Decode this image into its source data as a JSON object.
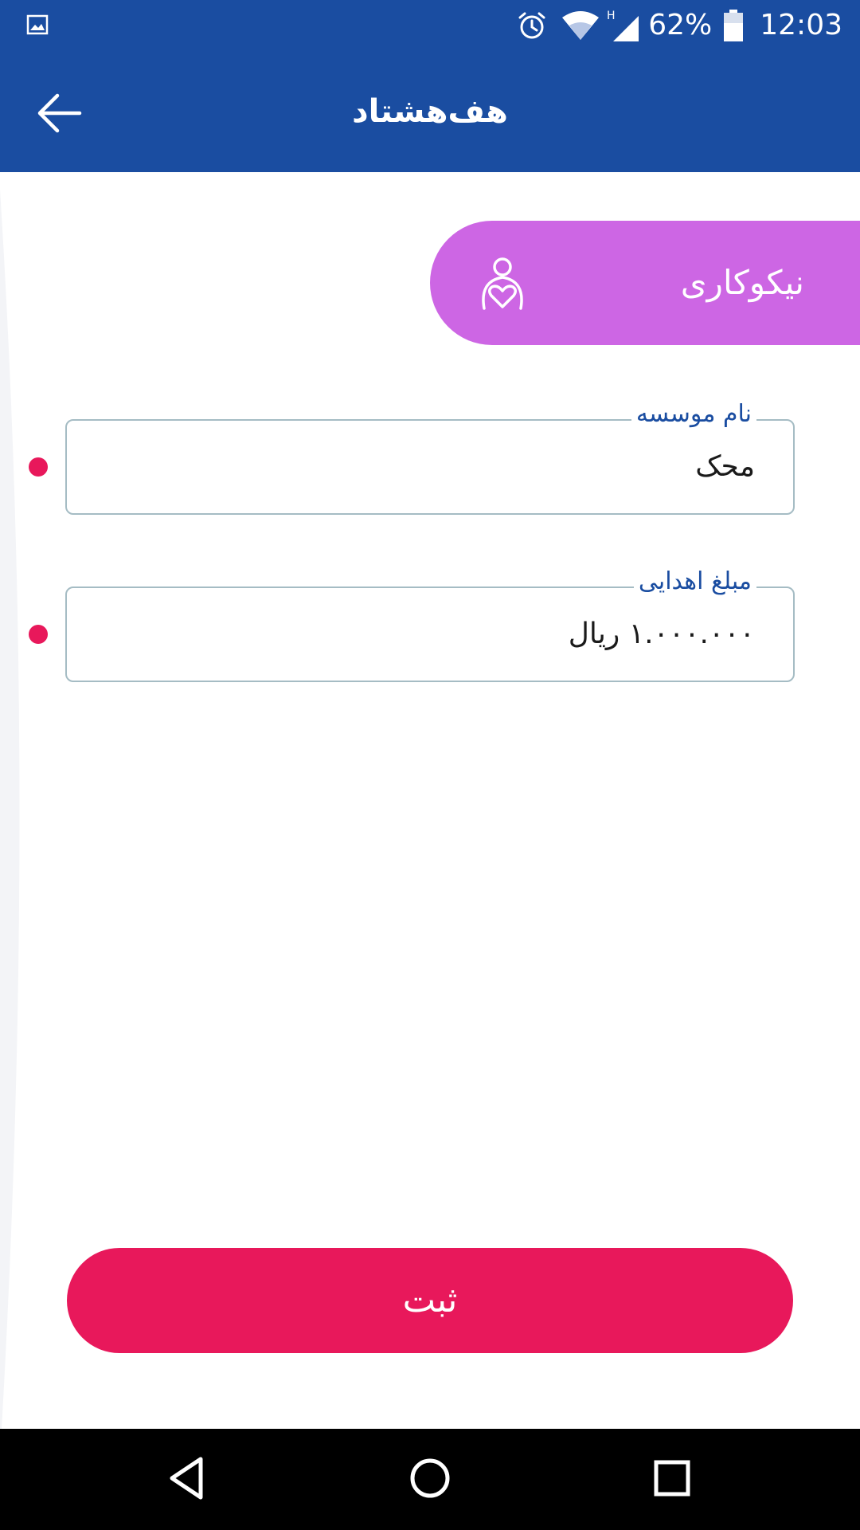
{
  "status_bar": {
    "left_icon": "image-icon",
    "icons": [
      "alarm-icon",
      "wifi-icon",
      "signal-icon",
      "battery-icon"
    ],
    "network_type": "H",
    "battery": "62%",
    "time": "12:03"
  },
  "header": {
    "title": "هف‌هشتاد",
    "back_icon": "arrow-left-icon"
  },
  "category": {
    "label": "نیکوکاری",
    "icon": "charity-heart-icon",
    "color": "#cd66e4"
  },
  "form": {
    "institution": {
      "label": "نام موسسه",
      "value": "محک"
    },
    "amount": {
      "label": "مبلغ اهدایی",
      "value": "۱.۰۰۰.۰۰۰ ریال"
    }
  },
  "submit": {
    "label": "ثبت"
  },
  "colors": {
    "primary": "#1a4da1",
    "accent": "#e8185b",
    "field_border": "#a5bcc4"
  },
  "nav": {
    "back": "triangle-back-icon",
    "home": "circle-home-icon",
    "recents": "square-recents-icon"
  }
}
